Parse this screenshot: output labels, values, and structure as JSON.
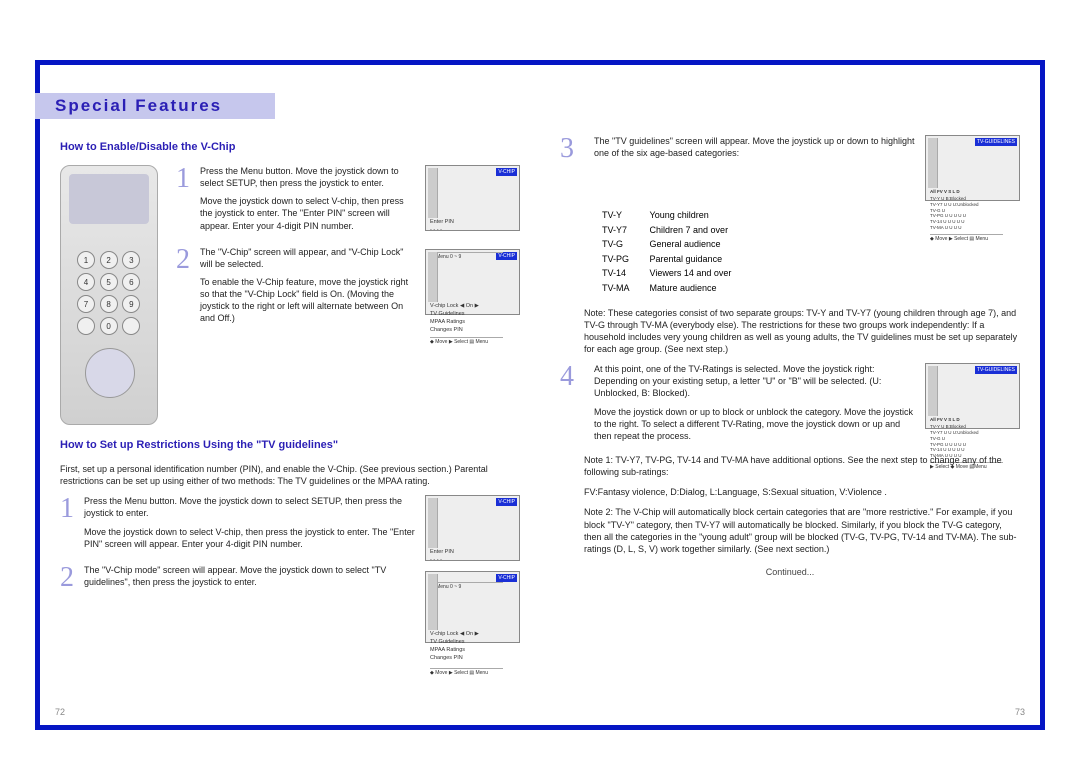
{
  "header": {
    "title": "Special Features"
  },
  "left": {
    "sub1": "How to Enable/Disable the V-Chip",
    "step1a": "Press the Menu button.  Move the joystick down to select SETUP, then press the joystick to enter.",
    "step1b": "Move the joystick down to select V-chip, then press the joystick to enter.  The \"Enter PIN\" screen will appear.  Enter your 4-digit PIN number.",
    "step2a": "The \"V-Chip\" screen will appear, and \"V-Chip Lock\" will be selected.",
    "step2b": "To enable the V-Chip feature, move the joystick right so that the \"V-Chip Lock\" field is On. (Moving the joystick to the right or left will alternate between On and Off.)",
    "sub2": "How to Set up Restrictions Using the \"TV guidelines\"",
    "intro": "First, set up a personal identification number (PIN), and enable the V-Chip. (See previous section.) Parental restrictions can be set up using either of two methods: The TV guidelines or the MPAA rating.",
    "bstep1a": "Press the Menu button.  Move the joystick down to select SETUP, then press the joystick to enter.",
    "bstep1b": "Move the joystick down to select V-chip, then press the joystick to enter. The \"Enter PIN\" screen will appear. Enter your 4-digit PIN number.",
    "bstep2": "The \"V-Chip mode\" screen will appear. Move the joystick down to select \"TV guidelines\", then press the joystick to enter.",
    "osd": {
      "vchip_title": "V-CHIP",
      "enter_pin": "Enter PIN",
      "dashes": "- - - -",
      "menu_footer": "▤ Menu        0 ~ 9",
      "vchip_lock": "V-chip Lock     ◀  On  ▶",
      "tv_guidelines": "TV Guidelines",
      "mpaa_ratings": "MPAA Ratings",
      "changes_pin": "Changes PIN",
      "move_footer": "◆ Move   ▶ Select   ▤ Menu"
    }
  },
  "right": {
    "step3a": "The \"TV guidelines\" screen will appear. Move the joystick up or down to highlight one of the six age-based categories:",
    "ratings": [
      [
        "TV-Y",
        "Young children"
      ],
      [
        "TV-Y7",
        "Children 7 and over"
      ],
      [
        "TV-G",
        "General audience"
      ],
      [
        "TV-PG",
        "Parental guidance"
      ],
      [
        "TV-14",
        "Viewers 14 and over"
      ],
      [
        "TV-MA",
        "Mature audience"
      ]
    ],
    "note_groups": "Note: These categories consist of two separate groups: TV-Y and TV-Y7 (young children through age 7), and TV-G through TV-MA (everybody else). The restrictions for these two groups work independently: If a household includes very young children as well as young adults, the TV guidelines must be set up separately for each age group. (See next step.)",
    "step4a": "At this point, one of the TV-Ratings is selected. Move the joystick right: Depending on your existing setup, a letter \"U\" or \"B\" will be selected. (U: Unblocked, B: Blocked).",
    "step4b": "Move the joystick down or up to block or unblock the category. Move the joystick to the right. To select a different TV-Rating, move the joystick down or up and then repeat the process.",
    "note1": "Note 1: TV-Y7, TV-PG, TV-14 and TV-MA have additional options.  See the next step to change any of the following sub-ratings:",
    "subratings": "FV:Fantasy violence, D:Dialog, L:Language, S:Sexual situation, V:Violence .",
    "note2": "Note 2: The V-Chip will automatically block certain categories that are \"more restrictive.\" For example, if you block \"TV-Y\" category, then TV-Y7 will automatically be blocked. Similarly, if you block the TV-G category, then all the categories in the \"young adult\" group will be blocked (TV-G, TV-PG, TV-14 and TV-MA). The sub-ratings (D, L, S, V) work together similarly. (See next section.)",
    "continued": "Continued...",
    "osd": {
      "tvg_title": "TV-GUIDELINES",
      "hdr": "All  FV  V   S   L   D",
      "r1": "TV-Y      U                    B:Blocked",
      "r2": "TV-Y7    U    U              U:Unblocked",
      "r3": "TV-G     U",
      "r4": "TV-PG   U         U  U  U  U",
      "r5": "TV-14    U         U  U  U  U",
      "r6": "TV-MA  U         U        U  U",
      "footer1": "◆ Move   ▶ Select   ▤ Menu",
      "footer2": "▶ Select   ◆ Move      ▤Menu"
    }
  },
  "page_left": "72",
  "page_right": "73"
}
